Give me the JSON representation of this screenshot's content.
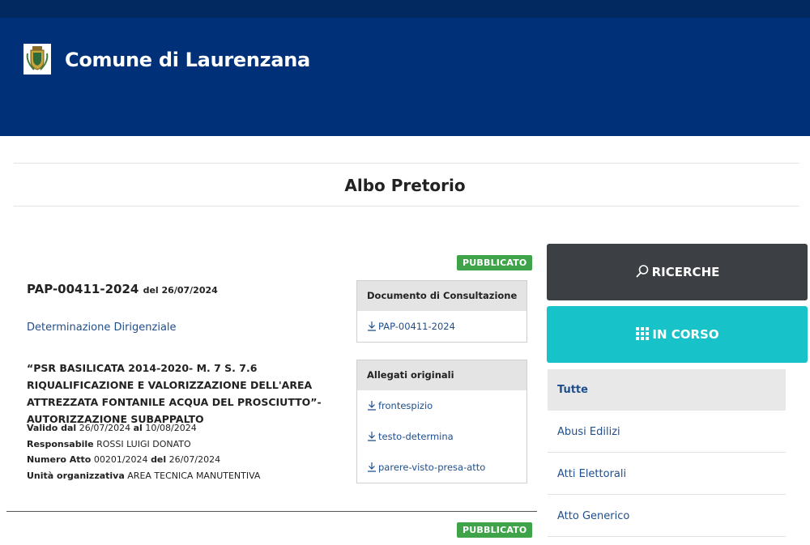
{
  "header": {
    "site_title": "Comune di Laurenzana"
  },
  "page": {
    "title": "Albo Pretorio"
  },
  "entries": [
    {
      "status": "PUBBLICATO",
      "code": "PAP-00411-2024",
      "date_label": "del 26/07/2024",
      "type": "Determinazione Dirigenziale",
      "subject": "“PSR BASILICATA 2014-2020- M. 7 S. 7.6 RIQUALIFICAZIONE E VALORIZZAZIONE DELL'AREA ATTREZZATA FONTANILE ACQUA DEL PROSCIUTTO”- AUTORIZZAZIONE SUBAPPALTO",
      "valid_label": "Valido dal",
      "valid_from": "26/07/2024",
      "valid_to_label": "al",
      "valid_to": "10/08/2024",
      "resp_label": "Responsabile",
      "resp": "ROSSI LUIGI DONATO",
      "num_label": "Numero Atto",
      "num": "00201/2024",
      "num_date_label": "del",
      "num_date": "26/07/2024",
      "unit_label": "Unità organizzativa",
      "unit": "AREA TECNICA MANUTENTIVA",
      "consult_title": "Documento di Consultazione",
      "consult_links": [
        "PAP-00411-2024"
      ],
      "attachments_title": "Allegati originali",
      "attachments": [
        "frontespizio",
        "testo-determina",
        "parere-visto-presa-atto"
      ]
    },
    {
      "status": "PUBBLICATO"
    }
  ],
  "sidebar": {
    "search_label": "RICERCHE",
    "current_label": "IN CORSO",
    "categories": [
      "Tutte",
      "Abusi Edilizi",
      "Atti Elettorali",
      "Atto Generico"
    ]
  },
  "colors": {
    "header": "#003178",
    "badge": "#3fa34a",
    "search_btn": "#3c3f44",
    "current_btn": "#17c3c8",
    "link": "#1f4e8c"
  },
  "icons": {
    "logo": "coat-of-arms-icon",
    "search": "search-icon",
    "grid": "grid-icon",
    "download": "download-icon"
  }
}
